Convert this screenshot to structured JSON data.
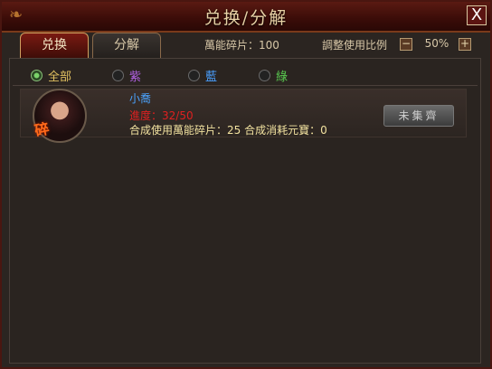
{
  "window": {
    "title": "兑换/分解",
    "close_label": "X"
  },
  "tabs": [
    {
      "label": "兑换",
      "active": true
    },
    {
      "label": "分解",
      "active": false
    }
  ],
  "header": {
    "shards_label": "萬能碎片：100",
    "ratio_label": "調整使用比例",
    "ratio_minus": "−",
    "ratio_value": "50%",
    "ratio_plus": "+"
  },
  "filters": [
    {
      "label": "全部",
      "selected": true,
      "color": "#e0c060"
    },
    {
      "label": "紫",
      "selected": false,
      "color": "#b060e0"
    },
    {
      "label": "藍",
      "selected": false,
      "color": "#4aa0ff"
    },
    {
      "label": "綠",
      "selected": false,
      "color": "#5acc50"
    }
  ],
  "items": [
    {
      "avatar_icon": "character-portrait-icon",
      "shard_badge": "碎",
      "name": "小喬",
      "progress": "進度：32/50",
      "cost": "合成使用萬能碎片：25   合成消耗元寶：0",
      "button_label": "未集齊"
    }
  ]
}
